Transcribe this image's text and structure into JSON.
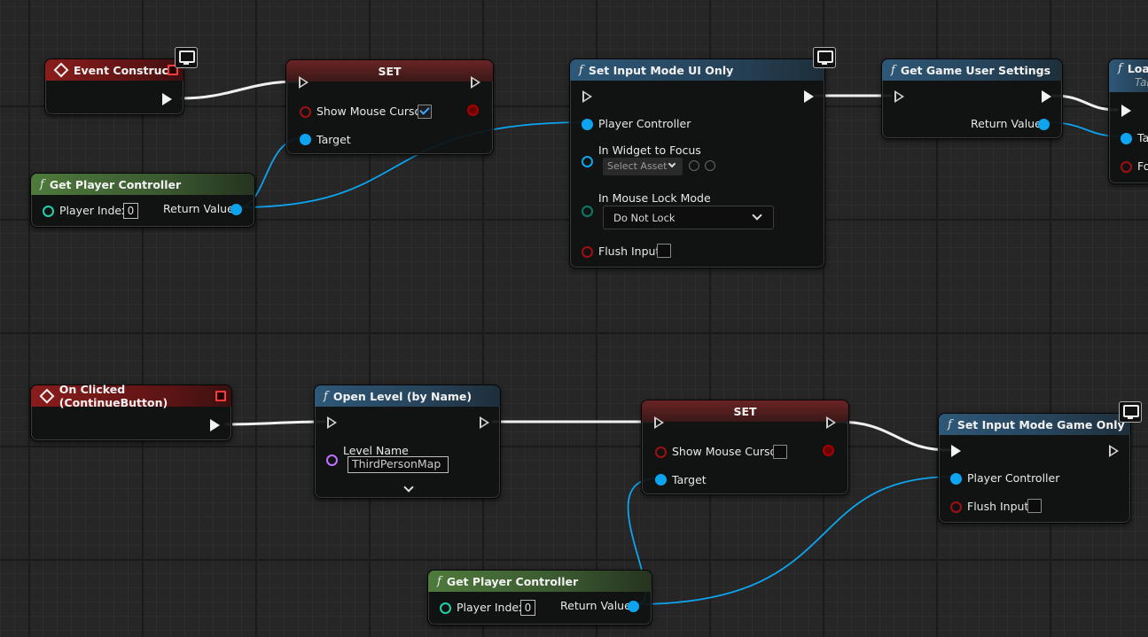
{
  "nodes": {
    "event_construct": {
      "title": "Event Construct"
    },
    "set_top": {
      "title": "SET",
      "show_mouse_cursor": "Show Mouse Cursor",
      "target": "Target"
    },
    "gpc_top": {
      "title": "Get Player Controller",
      "player_index": "Player Index",
      "index_value": "0",
      "return_value": "Return Value"
    },
    "set_input_ui": {
      "title": "Set Input Mode UI Only",
      "player_controller": "Player Controller",
      "widget_focus": "In Widget to Focus",
      "select_asset": "Select Asset",
      "mouse_lock": "In Mouse Lock Mode",
      "mouse_lock_value": "Do Not Lock",
      "flush_input": "Flush Input"
    },
    "game_user_settings": {
      "title": "Get Game User Settings",
      "return_value": "Return Value"
    },
    "partial_node": {
      "title": "Loa",
      "sub": "Tar",
      "pin1": "Ta",
      "pin2": "Fo"
    },
    "on_clicked": {
      "title": "On Clicked (ContinueButton)"
    },
    "open_level": {
      "title": "Open Level (by Name)",
      "level_name": "Level Name",
      "level_value": "ThirdPersonMap"
    },
    "set_bottom": {
      "title": "SET",
      "show_mouse_cursor": "Show Mouse Cursor",
      "target": "Target"
    },
    "gpc_bottom": {
      "title": "Get Player Controller",
      "player_index": "Player Index",
      "index_value": "0",
      "return_value": "Return Value"
    },
    "set_input_game": {
      "title": "Set Input Mode Game Only",
      "player_controller": "Player Controller",
      "flush_input": "Flush Input"
    }
  },
  "icons": {
    "function": "f",
    "event": "event-diamond-icon",
    "delegate": "delegate-square-icon",
    "client": "monitor-badge-icon"
  },
  "colors": {
    "exec_wire": "#f2f2f2",
    "object_wire": "#0da4f0",
    "bool_pin": "#a00000",
    "int_pin": "#1ed2aa",
    "name_pin": "#c070ff",
    "enum_pin": "#0c7a64"
  }
}
